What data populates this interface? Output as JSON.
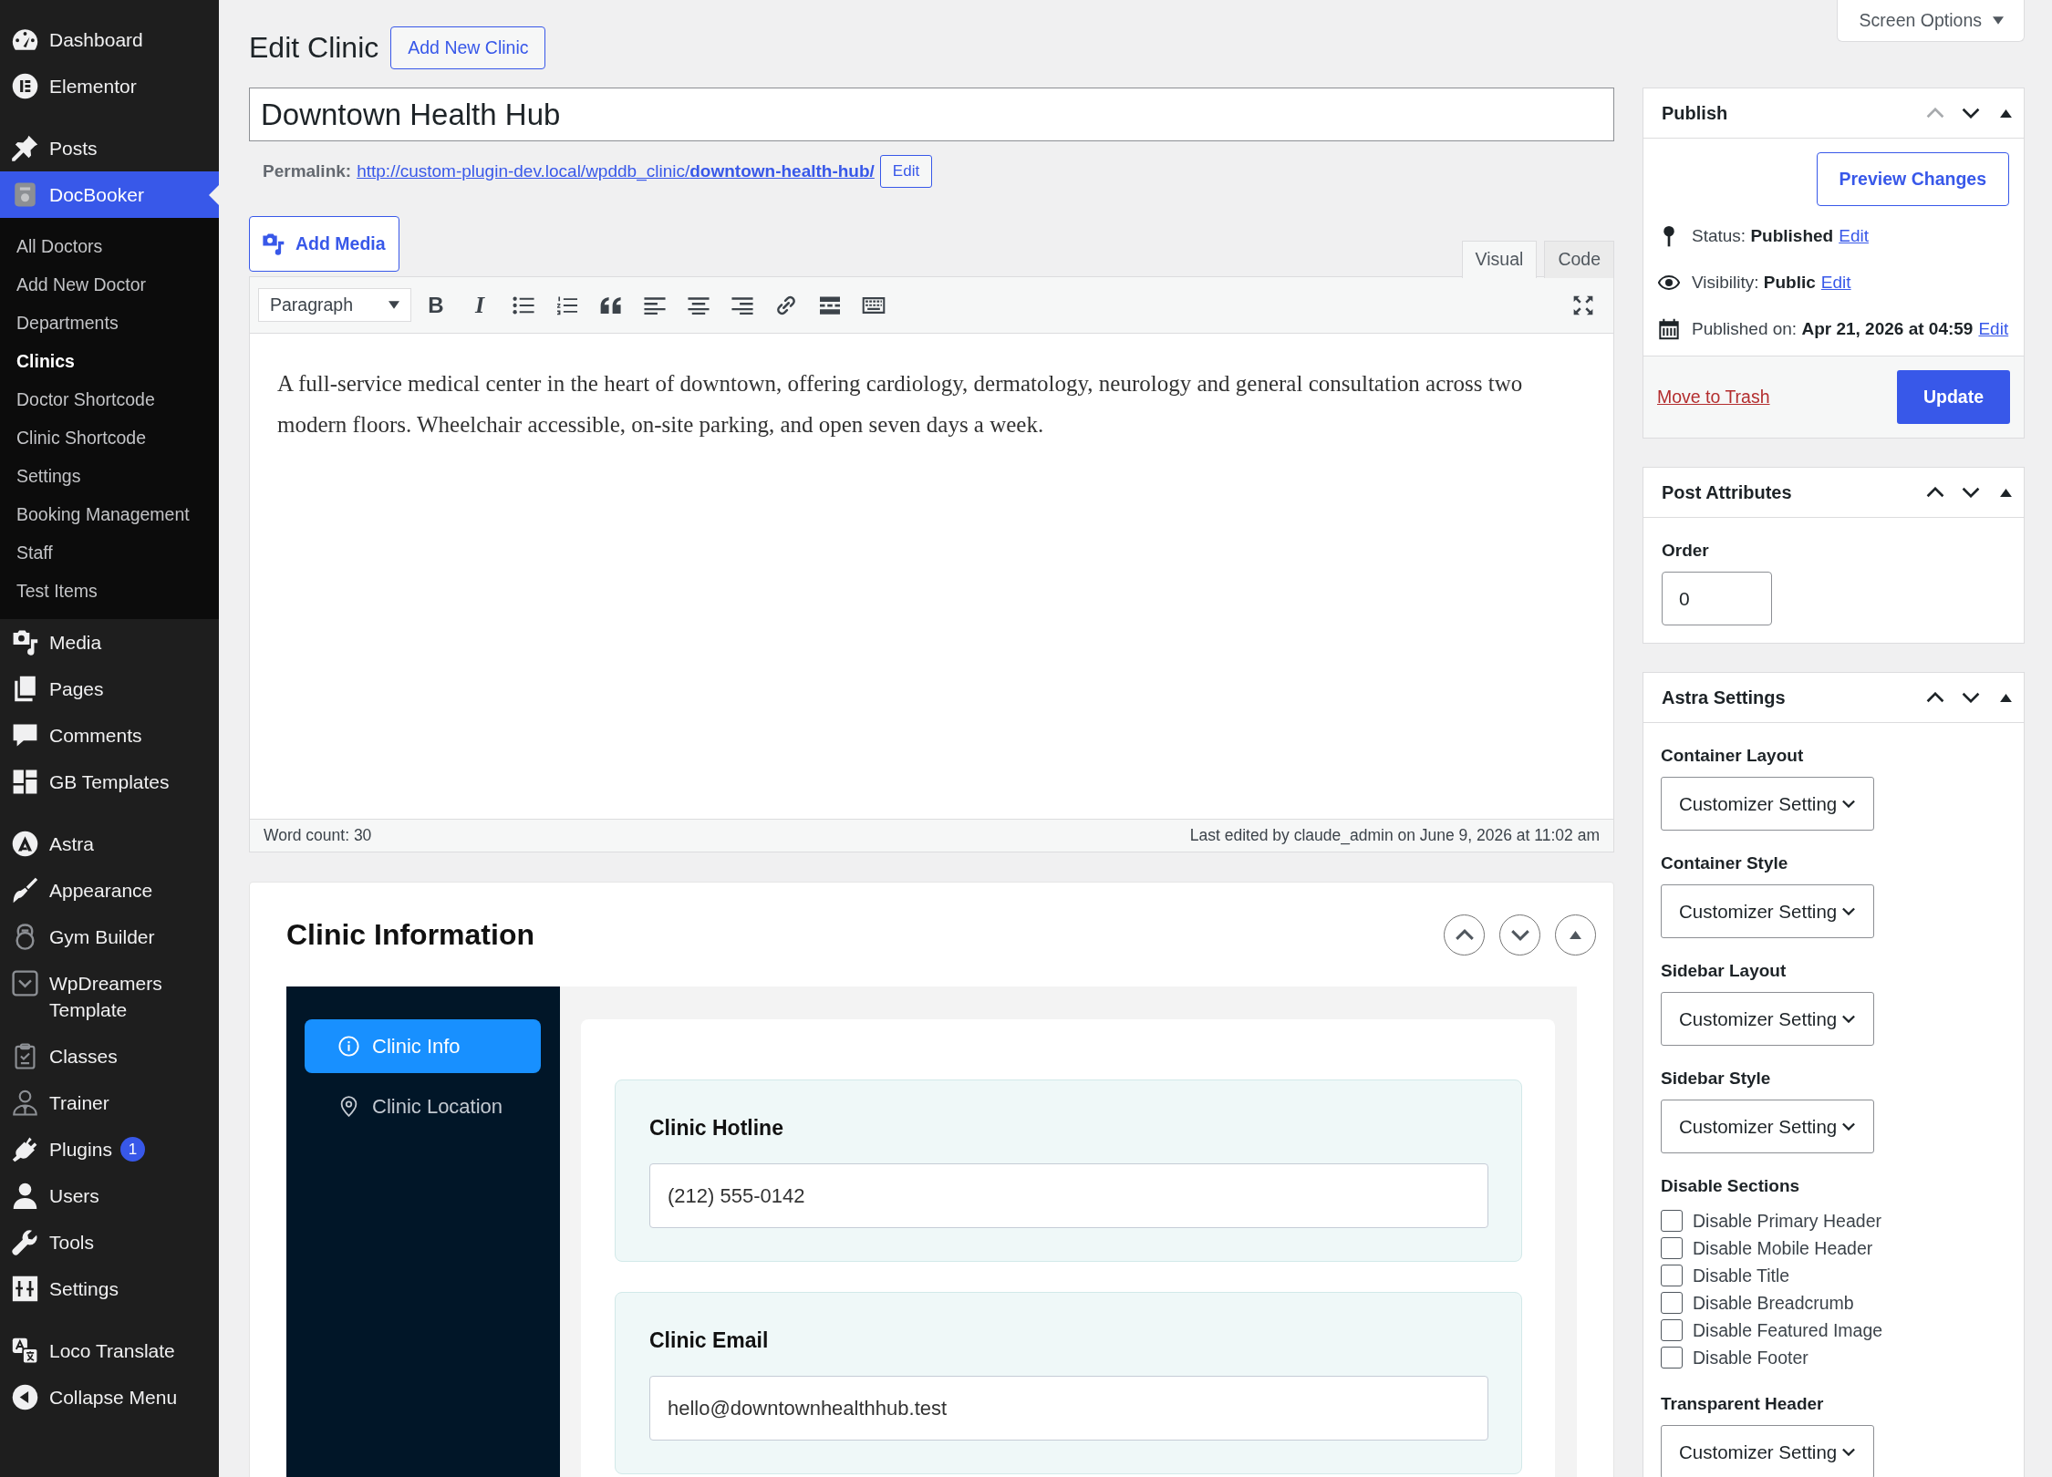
{
  "sidebar": {
    "groups": [
      {
        "items": [
          {
            "label": "Dashboard",
            "selected": false
          },
          {
            "label": "Elementor",
            "selected": false
          }
        ]
      },
      {
        "items": [
          {
            "label": "Posts",
            "selected": false
          },
          {
            "label": "DocBooker",
            "selected": true,
            "children": [
              {
                "label": "All Doctors",
                "selected": false
              },
              {
                "label": "Add New Doctor",
                "selected": false
              },
              {
                "label": "Departments",
                "selected": false
              },
              {
                "label": "Clinics",
                "selected": true
              },
              {
                "label": "Doctor Shortcode",
                "selected": false
              },
              {
                "label": "Clinic Shortcode",
                "selected": false
              },
              {
                "label": "Settings",
                "selected": false
              },
              {
                "label": "Booking Management",
                "selected": false
              },
              {
                "label": "Staff",
                "selected": false
              },
              {
                "label": "Test Items",
                "selected": false
              }
            ]
          },
          {
            "label": "Media",
            "selected": false
          },
          {
            "label": "Pages",
            "selected": false
          },
          {
            "label": "Comments",
            "selected": false
          },
          {
            "label": "GB Templates",
            "selected": false
          }
        ]
      },
      {
        "items": [
          {
            "label": "Astra",
            "selected": false
          },
          {
            "label": "Appearance",
            "selected": false
          },
          {
            "label": "Gym Builder",
            "selected": false
          },
          {
            "label": "WpDreamers Template",
            "selected": false
          },
          {
            "label": "Classes",
            "selected": false
          },
          {
            "label": "Trainer",
            "selected": false
          },
          {
            "label": "Plugins",
            "selected": false,
            "badge": "1"
          },
          {
            "label": "Users",
            "selected": false
          },
          {
            "label": "Tools",
            "selected": false
          },
          {
            "label": "Settings",
            "selected": false
          }
        ]
      },
      {
        "items": [
          {
            "label": "Loco Translate",
            "selected": false
          },
          {
            "label": "Collapse Menu",
            "selected": false
          }
        ]
      }
    ]
  },
  "screen_options": "Screen Options",
  "header": {
    "title": "Edit Clinic",
    "add_new_button": "Add New Clinic"
  },
  "post_title": {
    "value": "Downtown Health Hub"
  },
  "permalink": {
    "label": "Permalink:",
    "url": "http://custom-plugin-dev.local/wpddb_clinic/**downtown-health-hub/**",
    "edit_button": "Edit"
  },
  "editor": {
    "add_media_button": "Add Media",
    "tabs": [
      {
        "label": "Visual",
        "selected": true
      },
      {
        "label": "Code",
        "selected": false
      }
    ],
    "format": "Paragraph",
    "bold_label": "B",
    "italic_label": "I",
    "content": "A full-service medical center in the heart of downtown, offering cardiology, dermatology, neurology and general consultation across two modern floors. Wheelchair accessible, on-site parking, and open seven days a week.",
    "word_count": "Word count: 30",
    "last_edited": "Last edited by claude_admin on June 9, 2026 at 11:02 am"
  },
  "clinic_information": {
    "title": "Clinic Information",
    "tabs": [
      {
        "label": "Clinic Info",
        "selected": true
      },
      {
        "label": "Clinic Location",
        "selected": false
      }
    ],
    "fields": [
      {
        "label": "Clinic Hotline",
        "value": "(212) 555-0142"
      },
      {
        "label": "Clinic Email",
        "value": "hello@downtownhealthhub.test"
      }
    ]
  },
  "publish": {
    "title": "Publish",
    "up_disabled": true,
    "preview_button": "Preview Changes",
    "rows": [
      {
        "label": "Status:",
        "value": "Published",
        "link": "Edit"
      },
      {
        "label": "Visibility:",
        "value": "Public",
        "link": "Edit"
      },
      {
        "label": "Published on:",
        "value": "Apr 21, 2026 at 04:59",
        "link": "Edit"
      }
    ],
    "trash_link": "Move to Trash",
    "update_button": "Update"
  },
  "post_attributes": {
    "title": "Post Attributes",
    "up_disabled": false,
    "order_label": "Order",
    "order_value": "0"
  },
  "astra_settings": {
    "title": "Astra Settings",
    "up_disabled": false,
    "fields": [
      {
        "kind": "select",
        "label": "Container Layout",
        "value": "Customizer Setting"
      },
      {
        "kind": "select",
        "label": "Container Style",
        "value": "Customizer Setting"
      },
      {
        "kind": "select",
        "label": "Sidebar Layout",
        "value": "Customizer Setting"
      },
      {
        "kind": "select",
        "label": "Sidebar Style",
        "value": "Customizer Setting"
      },
      {
        "kind": "checkboxes",
        "label": "Disable Sections",
        "options": [
          {
            "label": "Disable Primary Header",
            "checked": false
          },
          {
            "label": "Disable Mobile Header",
            "checked": false
          },
          {
            "label": "Disable Title",
            "checked": false
          },
          {
            "label": "Disable Breadcrumb",
            "checked": false
          },
          {
            "label": "Disable Featured Image",
            "checked": false
          },
          {
            "label": "Disable Footer",
            "checked": false
          }
        ]
      },
      {
        "kind": "select",
        "label": "Transparent Header",
        "value": "Customizer Setting"
      }
    ]
  }
}
